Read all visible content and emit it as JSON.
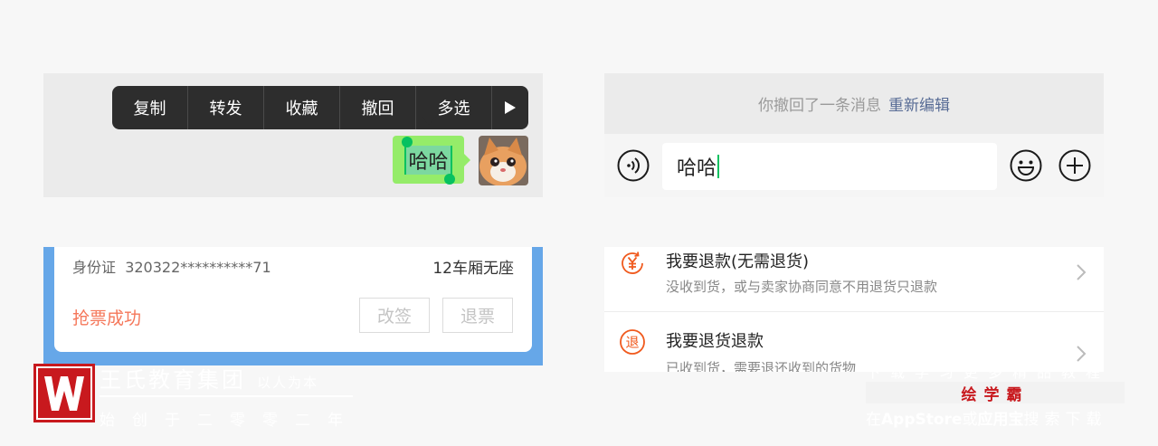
{
  "chat_menu": {
    "items": [
      "复制",
      "转发",
      "收藏",
      "撤回",
      "多选"
    ],
    "more_icon": "play-right-icon"
  },
  "chat": {
    "selected_message": "哈哈",
    "bubble_color": "#95ec69",
    "avatar_icon": "cat-avatar"
  },
  "recall": {
    "notice": "你撤回了一条消息",
    "reedit_label": "重新编辑"
  },
  "input_bar": {
    "value": "哈哈",
    "voice_icon": "voice-icon",
    "emoji_icon": "emoji-icon",
    "plus_icon": "plus-icon"
  },
  "ticket": {
    "id_label": "身份证",
    "id_value": "320322**********71",
    "seat": "12车厢无座",
    "status": "抢票成功",
    "change_button": "改签",
    "refund_button": "退票",
    "status_color": "#f5775a"
  },
  "refund_options": [
    {
      "title": "我要退款(无需退货)",
      "desc": "没收到货，或与卖家协商同意不用退货只退款",
      "icon": "yen-refund-icon"
    },
    {
      "title": "我要退货退款",
      "desc": "已收到货，需要退还收到的货物",
      "icon": "tui-icon"
    }
  ],
  "watermark": {
    "logo_letter": "W",
    "left_title": "王氏教育集团",
    "left_motto": "以人为本",
    "left_sub": "始创于二零零二年",
    "right_top": "下载学习更多精品教程",
    "brand": "绘学霸",
    "right_bottom_1": "在",
    "right_bottom_store": "AppStore",
    "right_bottom_2": "或",
    "right_bottom_app": "应用宝",
    "right_bottom_3": "搜索下载"
  }
}
